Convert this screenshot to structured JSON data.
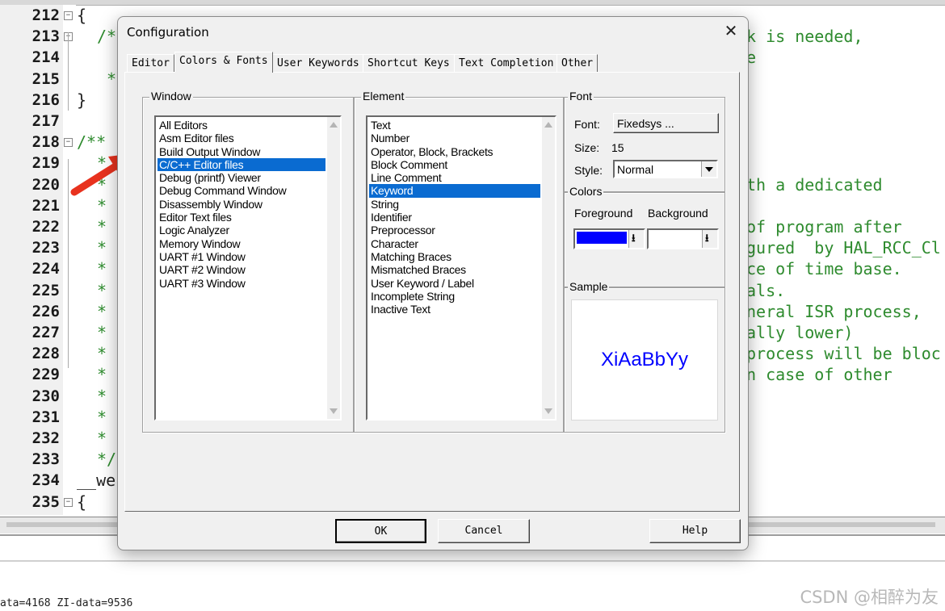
{
  "editor": {
    "line_numbers": [
      "212",
      "213",
      "214",
      "215",
      "216",
      "217",
      "218",
      "219",
      "220",
      "221",
      "222",
      "223",
      "224",
      "225",
      "226",
      "227",
      "228",
      "229",
      "230",
      "231",
      "232",
      "233",
      "234",
      "235"
    ],
    "left_code": {
      "l212": "{",
      "l213": "/*",
      "l215": "*",
      "l216": "}",
      "l218": "/**",
      "l219": "*",
      "l220": "*",
      "l221": "*",
      "l222": "*",
      "l223": "*",
      "l224": "*",
      "l225": "*",
      "l226": "*",
      "l227": "*",
      "l228": "*",
      "l229": "*",
      "l230": "*",
      "l231": "*",
      "l232": "*",
      "l233": "*/",
      "l234": "__we",
      "l235": "{"
    },
    "right_code": {
      "l213": "k is needed,",
      "l214": "e",
      "l220": "th a dedicated",
      "l222": "of program after",
      "l223": "gured  by HAL_RCC_Cl",
      "l224": "ce of time base.",
      "l225": "als.",
      "l226": "neral ISR process,",
      "l227": "ally lower)",
      "l228": "process will be bloc",
      "l229": "n case of other"
    }
  },
  "build_output": {
    "text": "ata=4168 ZI-data=9536"
  },
  "watermark": "CSDN @相醉为友",
  "dialog": {
    "title": "Configuration",
    "close_glyph": "✕",
    "tabs": [
      "Editor",
      "Colors & Fonts",
      "User Keywords",
      "Shortcut Keys",
      "Text Completion",
      "Other"
    ],
    "active_tab": "Colors & Fonts",
    "window_group": {
      "label": "Window",
      "items": [
        "All Editors",
        "Asm Editor files",
        "Build Output Window",
        "C/C++ Editor files",
        "Debug (printf) Viewer",
        "Debug Command Window",
        "Disassembly Window",
        "Editor Text files",
        "Logic Analyzer",
        "Memory Window",
        "UART #1 Window",
        "UART #2 Window",
        "UART #3 Window"
      ],
      "selected": "C/C++ Editor files"
    },
    "element_group": {
      "label": "Element",
      "items": [
        "Text",
        "Number",
        "Operator, Block, Brackets",
        "Block Comment",
        "Line Comment",
        "Keyword",
        "String",
        "Identifier",
        "Preprocessor",
        "Character",
        "Matching Braces",
        "Mismatched Braces",
        "User Keyword / Label",
        "Incomplete String",
        "Inactive Text"
      ],
      "selected": "Keyword"
    },
    "font_group": {
      "label": "Font",
      "font_label": "Font:",
      "font_button": "Fixedsys ...",
      "size_label": "Size:",
      "size_value": "15",
      "style_label": "Style:",
      "style_value": "Normal"
    },
    "colors_group": {
      "label": "Colors",
      "foreground_label": "Foreground",
      "background_label": "Background",
      "foreground_color": "#0000ff",
      "background_color": "#ffffff",
      "dropdown_glyph": "⭳"
    },
    "sample_group": {
      "label": "Sample",
      "text": "XiAaBbYy",
      "color": "#0000ff"
    },
    "buttons": {
      "ok": "OK",
      "cancel": "Cancel",
      "help": "Help"
    }
  }
}
